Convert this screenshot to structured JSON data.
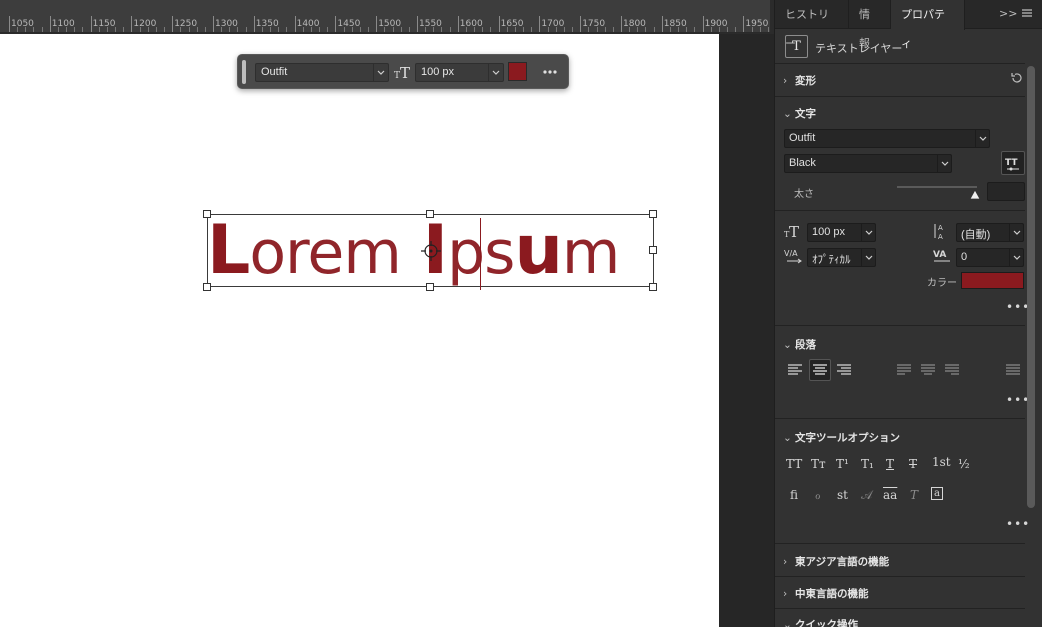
{
  "ruler": {
    "labels": [
      "1050",
      "1100",
      "1150",
      "1200",
      "1250",
      "1300",
      "1350",
      "1400",
      "1450",
      "1500",
      "1550",
      "1600",
      "1650",
      "1700",
      "1750",
      "1800",
      "1850",
      "1900",
      "1950"
    ]
  },
  "toolbar": {
    "font_family": "Outfit",
    "font_size": "100 px",
    "color": "#8b1a1f"
  },
  "text_layer": {
    "word1_cap": "L",
    "word1_rest": "orem",
    "word2_cap": "I",
    "word2_mid": "ps",
    "word2_bold": "u",
    "word2_end": "m",
    "color": "#8b1a1f"
  },
  "panel": {
    "tabs": [
      "ヒストリー",
      "情報",
      "プロパティ"
    ],
    "active_tab": "プロパティ",
    "overflow": ">>",
    "layer_kind": "テキストレイヤー",
    "transform": {
      "title": "変形"
    },
    "character": {
      "title": "文字",
      "font_family": "Outfit",
      "font_style": "Black",
      "weight_label": "太さ",
      "weight_value": "",
      "size": "100 px",
      "leading": "(自動)",
      "kerning": "ｵﾌﾟﾃｨｶﾙ",
      "tracking": "0",
      "color_label": "カラー",
      "color": "#8b1a1f"
    },
    "paragraph": {
      "title": "段落"
    },
    "type_options": {
      "title": "文字ツールオプション",
      "row1": [
        "TT",
        "Tт",
        "T¹",
        "T₁",
        "T",
        "T",
        "1st",
        "½"
      ],
      "row2": [
        "fi",
        "ℴ",
        "st",
        "𝒜",
        "aa",
        "T",
        "a"
      ]
    },
    "east_asian": {
      "title": "東アジア言語の機能"
    },
    "middle_east": {
      "title": "中東言語の機能"
    },
    "quick_actions": {
      "title": "クイック操作"
    },
    "more": "•••"
  }
}
